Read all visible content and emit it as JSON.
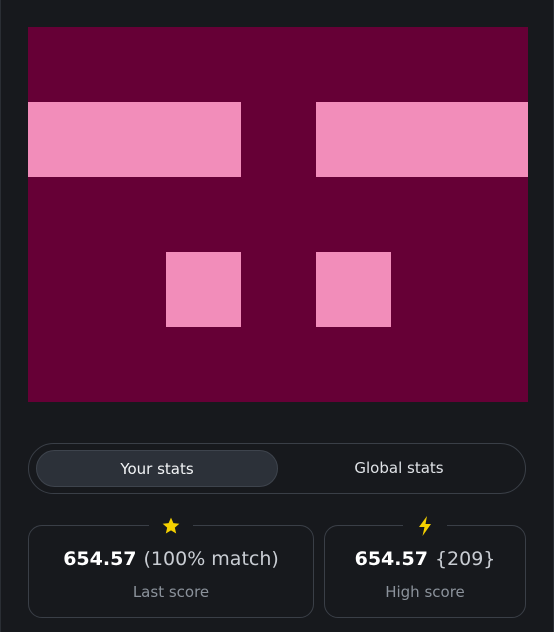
{
  "board": {
    "background_color": "#660036",
    "block_color": "#f28dba"
  },
  "tabs": [
    {
      "label": "Your stats",
      "active": true
    },
    {
      "label": "Global stats",
      "active": false
    }
  ],
  "stats": {
    "last": {
      "value": "654.57",
      "detail": "(100% match)",
      "label": "Last score",
      "icon": "star-icon",
      "icon_color": "#f5d100"
    },
    "high": {
      "value": "654.57",
      "detail": "{209}",
      "label": "High score",
      "icon": "lightning-icon",
      "icon_color": "#f5d100"
    }
  }
}
